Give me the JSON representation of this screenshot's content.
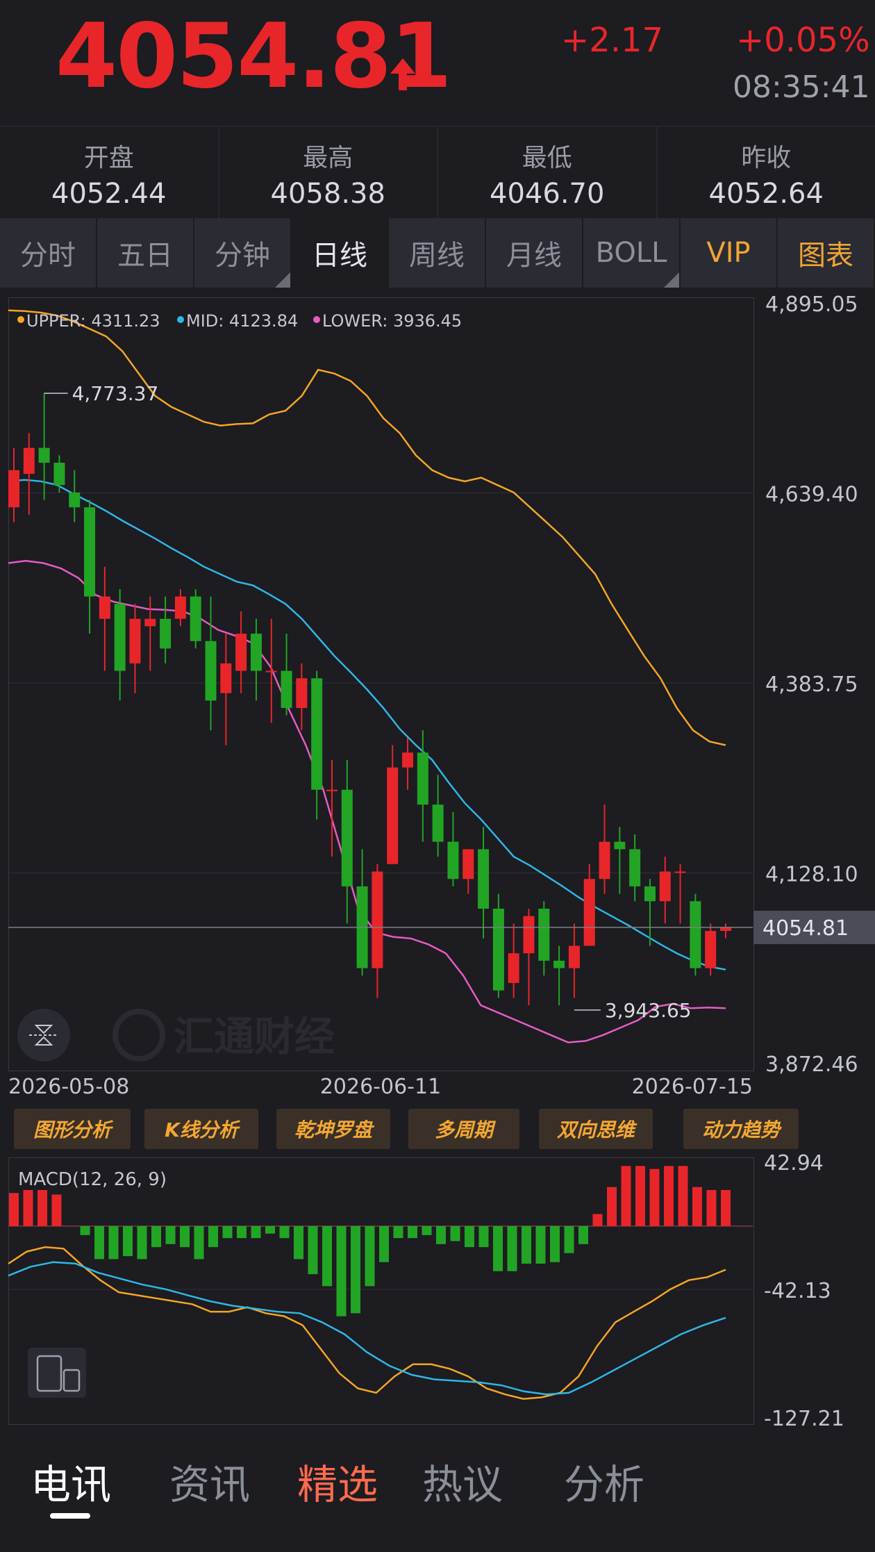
{
  "header": {
    "price": "4054.81",
    "change": "+2.17",
    "change_pct": "+0.05%",
    "time": "08:35:41",
    "accent_color": "#e8262a"
  },
  "stats": [
    {
      "label": "开盘",
      "value": "4052.44"
    },
    {
      "label": "最高",
      "value": "4058.38"
    },
    {
      "label": "最低",
      "value": "4046.70"
    },
    {
      "label": "昨收",
      "value": "4052.64"
    }
  ],
  "tabs": [
    {
      "label": "分时",
      "style": "normal",
      "corner": false
    },
    {
      "label": "五日",
      "style": "normal",
      "corner": false
    },
    {
      "label": "分钟",
      "style": "normal",
      "corner": true
    },
    {
      "label": "日线",
      "style": "active",
      "corner": false
    },
    {
      "label": "周线",
      "style": "normal",
      "corner": false
    },
    {
      "label": "月线",
      "style": "normal",
      "corner": false
    },
    {
      "label": "BOLL",
      "style": "normal",
      "corner": true
    },
    {
      "label": "VIP",
      "style": "gold",
      "corner": false
    },
    {
      "label": "图表",
      "style": "gold",
      "corner": false
    }
  ],
  "kline": {
    "legend": {
      "upper": "UPPER: 4311.23",
      "mid": "MID: 4123.84",
      "lower": "LOWER: 3936.45"
    },
    "colors": {
      "upper": "#f5a623",
      "mid": "#2fb7e6",
      "lower": "#e65cc3",
      "up": "#e8262a",
      "down": "#22a524"
    },
    "y_ticks": [
      "4,895.05",
      "4,639.40",
      "4,383.75",
      "4,128.10",
      "3,872.46"
    ],
    "y_range": [
      3872.46,
      4895.05
    ],
    "x_labels": [
      "2026-05-08",
      "2026-06-11",
      "2026-07-15"
    ],
    "high_label": "4,773.37",
    "low_label": "3,943.65",
    "last_price_label": "4054.81",
    "watermark": "汇通财经",
    "candles": [
      [
        4620,
        4700,
        4600,
        4670
      ],
      [
        4665,
        4720,
        4610,
        4700
      ],
      [
        4700,
        4773.37,
        4630,
        4680
      ],
      [
        4680,
        4690,
        4640,
        4650
      ],
      [
        4640,
        4670,
        4600,
        4620
      ],
      [
        4620,
        4630,
        4450,
        4500
      ],
      [
        4470,
        4540,
        4400,
        4500
      ],
      [
        4490,
        4510,
        4360,
        4400
      ],
      [
        4410,
        4490,
        4370,
        4470
      ],
      [
        4460,
        4500,
        4400,
        4470
      ],
      [
        4470,
        4500,
        4410,
        4430
      ],
      [
        4470,
        4510,
        4460,
        4500
      ],
      [
        4500,
        4510,
        4430,
        4440
      ],
      [
        4440,
        4500,
        4320,
        4360
      ],
      [
        4370,
        4450,
        4300,
        4410
      ],
      [
        4400,
        4480,
        4370,
        4450
      ],
      [
        4450,
        4470,
        4360,
        4400
      ],
      [
        4400,
        4470,
        4330,
        4400
      ],
      [
        4400,
        4450,
        4340,
        4350
      ],
      [
        4350,
        4410,
        4320,
        4390
      ],
      [
        4390,
        4400,
        4200,
        4240
      ],
      [
        4240,
        4280,
        4150,
        4240
      ],
      [
        4240,
        4280,
        4060,
        4110
      ],
      [
        4110,
        4160,
        3990,
        4000
      ],
      [
        4000,
        4140,
        3960,
        4130
      ],
      [
        4140,
        4300,
        4230,
        4270
      ],
      [
        4270,
        4310,
        4240,
        4290
      ],
      [
        4290,
        4320,
        4170,
        4220
      ],
      [
        4220,
        4260,
        4150,
        4170
      ],
      [
        4170,
        4210,
        4110,
        4120
      ],
      [
        4120,
        4160,
        4100,
        4160
      ],
      [
        4160,
        4190,
        4040,
        4080
      ],
      [
        4080,
        4100,
        3960,
        3970
      ],
      [
        3980,
        4060,
        3960,
        4020
      ],
      [
        4020,
        4080,
        3950,
        4070
      ],
      [
        4080,
        4090,
        3990,
        4010
      ],
      [
        4010,
        4030,
        3950,
        4000
      ],
      [
        4000,
        4060,
        3960,
        4030
      ],
      [
        4030,
        4140,
        4040,
        4120
      ],
      [
        4120,
        4220,
        4100,
        4170
      ],
      [
        4170,
        4190,
        4100,
        4160
      ],
      [
        4160,
        4180,
        4090,
        4110
      ],
      [
        4110,
        4120,
        4030,
        4090
      ],
      [
        4090,
        4150,
        4060,
        4130
      ],
      [
        4130,
        4140,
        4060,
        4130
      ],
      [
        4090,
        4100,
        3990,
        4000
      ],
      [
        4000,
        4060,
        3990,
        4050
      ],
      [
        4050,
        4060,
        4040,
        4054.81
      ]
    ],
    "upper_band": [
      4885,
      4884,
      4882,
      4878,
      4870,
      4860,
      4850,
      4830,
      4800,
      4770,
      4755,
      4745,
      4735,
      4730,
      4732,
      4733,
      4745,
      4750,
      4770,
      4805,
      4800,
      4790,
      4770,
      4740,
      4720,
      4690,
      4670,
      4660,
      4655,
      4660,
      4650,
      4640,
      4620,
      4600,
      4580,
      4555,
      4530,
      4490,
      4455,
      4420,
      4390,
      4350,
      4320,
      4305,
      4300
    ],
    "mid_band": [
      4655,
      4657,
      4655,
      4650,
      4638,
      4627,
      4615,
      4602,
      4590,
      4578,
      4565,
      4553,
      4540,
      4530,
      4520,
      4515,
      4503,
      4490,
      4470,
      4445,
      4420,
      4398,
      4375,
      4350,
      4322,
      4300,
      4280,
      4250,
      4222,
      4200,
      4175,
      4150,
      4138,
      4124,
      4110,
      4095,
      4082,
      4070,
      4058,
      4045,
      4032,
      4020,
      4010,
      4002,
      3998
    ],
    "lower_band": [
      4545,
      4548,
      4545,
      4538,
      4525,
      4502,
      4493,
      4488,
      4483,
      4482,
      4480,
      4470,
      4455,
      4447,
      4437,
      4405,
      4350,
      4300,
      4240,
      4160,
      4080,
      4048,
      4042,
      4040,
      4032,
      4020,
      3990,
      3950,
      3940,
      3930,
      3920,
      3910,
      3900,
      3902,
      3910,
      3920,
      3930,
      3948,
      3952,
      3946,
      3947,
      3946
    ]
  },
  "tools": [
    "图形分析",
    "K线分析",
    "乾坤罗盘",
    "多周期",
    "双向思维",
    "动力趋势"
  ],
  "macd": {
    "label": "MACD(12, 26, 9)",
    "y_ticks": [
      "42.94",
      "-42.13",
      "-127.21"
    ],
    "y_range": [
      -127.21,
      42.94
    ],
    "hist": [
      22,
      24,
      24,
      21,
      0,
      -6,
      -22,
      -22,
      -20,
      -22,
      -14,
      -12,
      -14,
      -22,
      -14,
      -8,
      -8,
      -8,
      -5,
      -8,
      -22,
      -32,
      -40,
      -60,
      -58,
      -40,
      -24,
      -8,
      -8,
      -6,
      -12,
      -10,
      -14,
      -14,
      -30,
      -30,
      -25,
      -25,
      -24,
      -18,
      -12,
      8,
      26,
      40,
      40,
      38,
      40,
      40,
      26,
      24,
      24
    ],
    "dif": [
      -25,
      -17,
      -14,
      -15,
      -26,
      -36,
      -44,
      -46,
      -48,
      -50,
      -52,
      -57,
      -57,
      -54,
      -58,
      -60,
      -66,
      -82,
      -98,
      -108,
      -111,
      -100,
      -92,
      -92,
      -95,
      -100,
      -108,
      -112,
      -115,
      -114,
      -111,
      -100,
      -80,
      -64,
      -57,
      -50,
      -42,
      -36,
      -34,
      -29
    ],
    "dea": [
      -33,
      -27,
      -24,
      -25,
      -31,
      -35,
      -39,
      -42,
      -46,
      -50,
      -53,
      -55,
      -57,
      -58,
      -64,
      -72,
      -84,
      -93,
      -99,
      -102,
      -103,
      -104,
      -106,
      -110,
      -112,
      -111,
      -104,
      -96,
      -88,
      -80,
      -72,
      -66,
      -61
    ],
    "colors": {
      "dif": "#f5a623",
      "dea": "#2fb7e6",
      "up": "#e8262a",
      "down": "#22a524"
    }
  },
  "bottom_nav": [
    {
      "label": "电讯",
      "style": "active"
    },
    {
      "label": "资讯",
      "style": "normal"
    },
    {
      "label": "精选",
      "style": "highlight"
    },
    {
      "label": "热议",
      "style": "normal"
    },
    {
      "label": "分析",
      "style": "normal"
    }
  ]
}
